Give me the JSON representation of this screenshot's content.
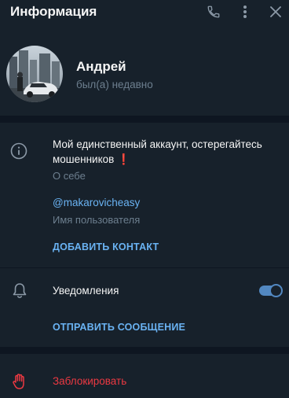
{
  "header": {
    "title": "Информация",
    "call_icon": "phone-icon",
    "more_icon": "more-vertical-icon",
    "close_icon": "close-icon"
  },
  "profile": {
    "name": "Андрей",
    "status": "был(а) недавно"
  },
  "about": {
    "bio": "Мой единственный аккаунт, остерегайтесь мошенников",
    "bio_emoji": "❗",
    "bio_caption": "О себе",
    "username": "@makarovicheasy",
    "username_caption": "Имя пользователя",
    "add_contact_label": "ДОБАВИТЬ КОНТАКТ"
  },
  "notifications": {
    "label": "Уведомления",
    "enabled": true,
    "send_message_label": "ОТПРАВИТЬ СООБЩЕНИЕ"
  },
  "block": {
    "label": "Заблокировать"
  },
  "colors": {
    "background": "#17212b",
    "divider": "#0e1621",
    "accent": "#6ab3f3",
    "toggle": "#5288c1",
    "muted": "#6d7f8f",
    "danger": "#ec3942"
  }
}
